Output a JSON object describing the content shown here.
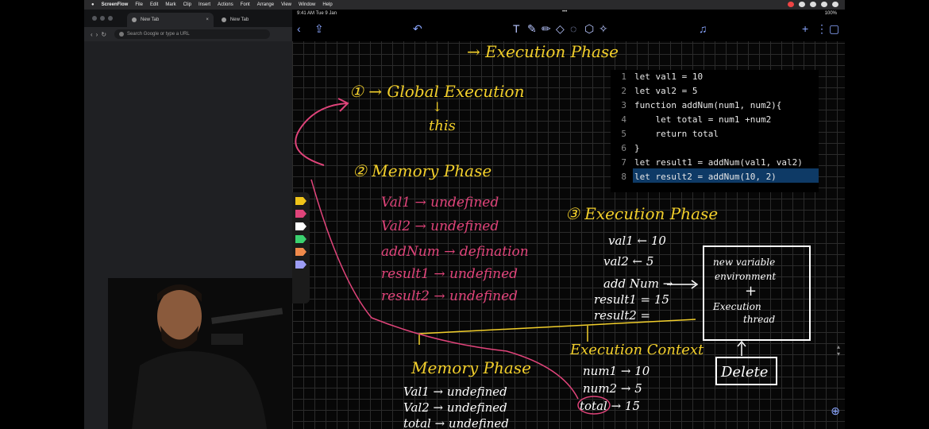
{
  "menubar": {
    "app": "ScreenFlow",
    "items": [
      "File",
      "Edit",
      "Mark",
      "Clip",
      "Insert",
      "Actions",
      "Font",
      "Arrange",
      "View",
      "Window",
      "Help"
    ]
  },
  "browser": {
    "tabs": [
      {
        "label": "New Tab"
      },
      {
        "label": "New Tab"
      }
    ],
    "omnibox_placeholder": "Search Google or type a URL"
  },
  "ipad": {
    "time": "9:41 AM  Tue 9 Jan",
    "status_center": "•••",
    "battery": "100%",
    "palette_colors": [
      "#f0c419",
      "#e0447a",
      "#ffffff",
      "#3bd16f",
      "#f08a4b",
      "#9d9df5"
    ]
  },
  "code": {
    "lines": [
      {
        "n": "1",
        "text": "let val1 = 10"
      },
      {
        "n": "2",
        "text": "let val2 = 5"
      },
      {
        "n": "3",
        "text": "function addNum(num1, num2){"
      },
      {
        "n": "4",
        "text": "    let total = num1 +num2"
      },
      {
        "n": "5",
        "text": "    return total"
      },
      {
        "n": "6",
        "text": "}"
      },
      {
        "n": "7",
        "text": "let result1 = addNum(val1, val2)"
      },
      {
        "n": "8",
        "text": "let result2 = addNum(10, 2)"
      }
    ],
    "selected_line": 8
  },
  "notes": {
    "top": "→ Execution Phase",
    "global": "① → Global Execution",
    "arrow_down": "↓",
    "this": "this",
    "memory_title": "② Memory Phase",
    "memory_items": [
      "Val1 → undefined",
      "Val2 → undefined",
      "addNum → defination",
      "result1 → undefined",
      "result2 → undefined"
    ],
    "exec_title": "③ Execution Phase",
    "exec_items": [
      "val1 ← 10",
      "val2 ← 5",
      "add Num →",
      "result1 = 15",
      "result2 ="
    ],
    "box_line1": "new variable",
    "box_line2": "environment",
    "box_plus": "+",
    "box_line3": "Execution",
    "box_line4": "thread",
    "delete": "Delete",
    "memory2_title": "Memory Phase",
    "memory2_items": [
      "Val1 → undefined",
      "Val2 → undefined",
      "total → undefined"
    ],
    "context_title": "Execution Context",
    "context_items": [
      "num1 → 10",
      "num2 → 5",
      "total → 15"
    ]
  }
}
